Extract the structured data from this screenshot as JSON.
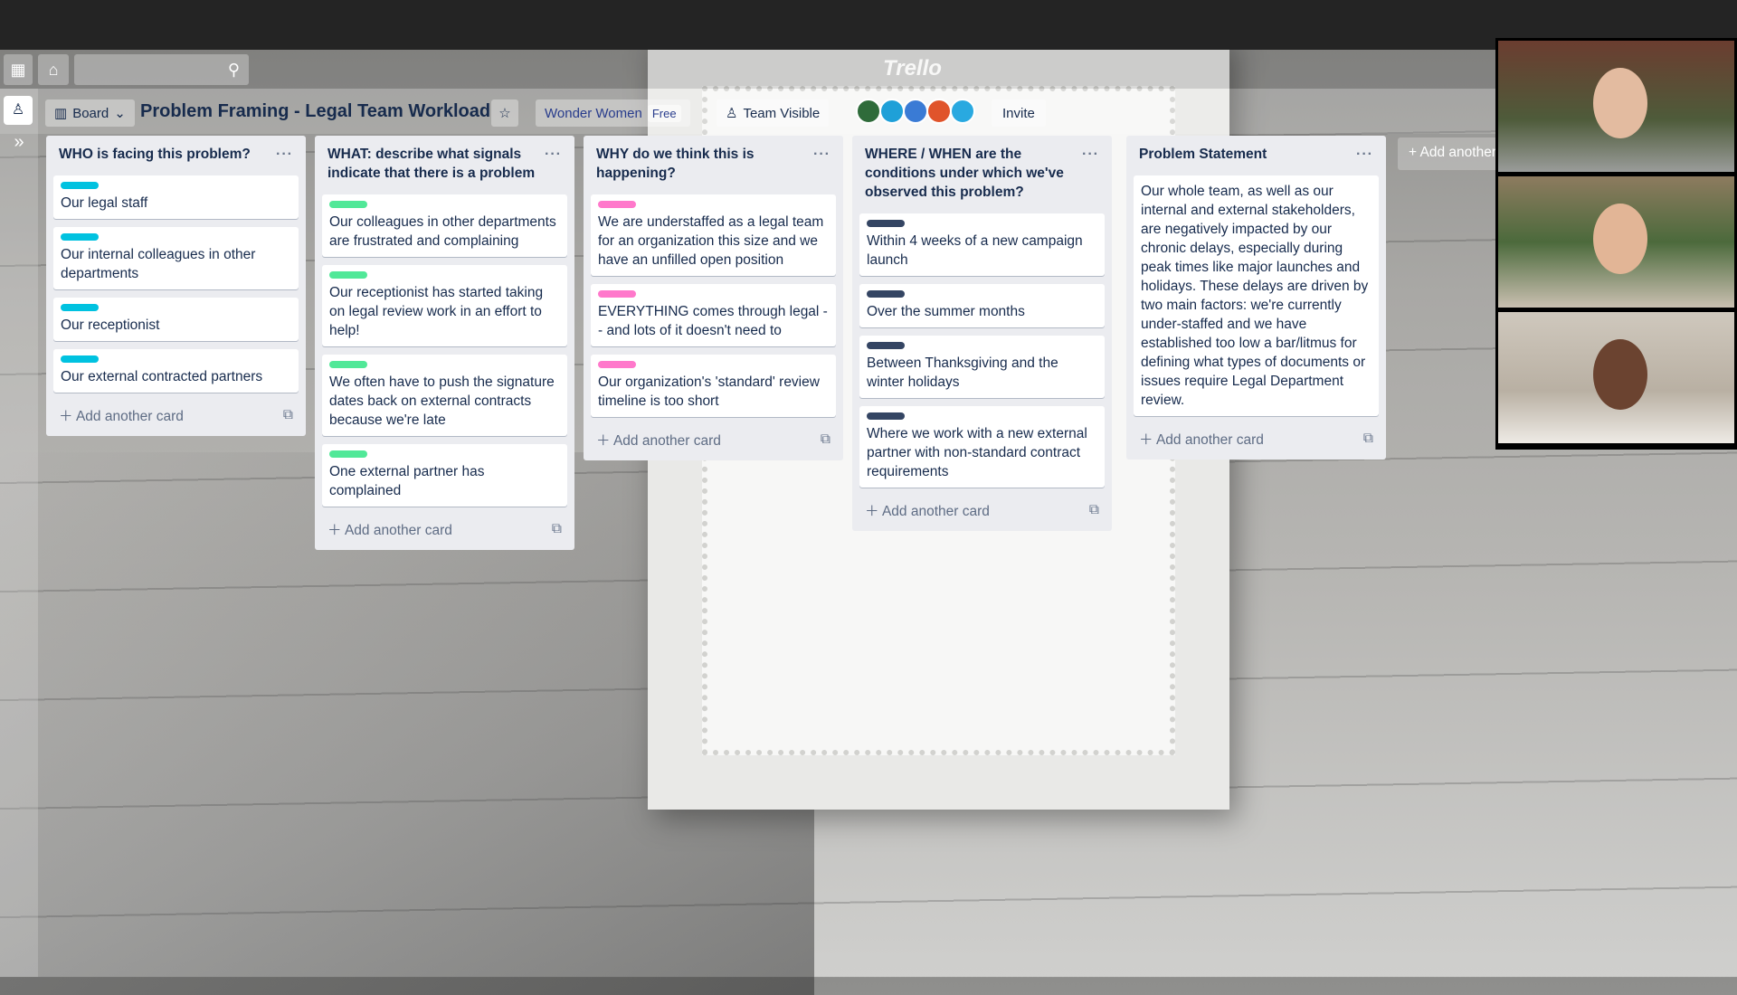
{
  "header": {
    "board_switch": "Board",
    "board_title": "Problem Framing - Legal Team Workload",
    "team": "Wonder Women",
    "plan": "Free",
    "visibility": "Team Visible",
    "invite": "Invite",
    "logo": "Trello",
    "search_placeholder": ""
  },
  "members": [
    {
      "color": "#2f6b3a"
    },
    {
      "color": "#1fa0d8"
    },
    {
      "color": "#3a7bd5"
    },
    {
      "color": "#e0542b"
    },
    {
      "color": "#29a9e0"
    }
  ],
  "add_card_label": "Add another card",
  "add_list_label": "Add another list",
  "lists": [
    {
      "title": "WHO is facing this problem?",
      "label_color": "#00c2e0",
      "cards": [
        "Our legal staff",
        "Our internal colleagues in other departments",
        "Our receptionist",
        "Our external contracted partners"
      ]
    },
    {
      "title": "WHAT: describe what signals indicate that there is a problem",
      "label_color": "#51e898",
      "cards": [
        "Our colleagues in other departments are frustrated and complaining",
        "Our receptionist has started taking on legal review work in an effort to help!",
        "We often have to push the signature dates back on external contracts because we're late",
        "One external partner has complained"
      ]
    },
    {
      "title": "WHY do we think this is happening?",
      "label_color": "#ff78cb",
      "cards": [
        "We are understaffed as a legal team for an organization this size and we have an unfilled open position",
        "EVERYTHING comes through legal -- and lots of it doesn't need to",
        "Our organization's 'standard' review timeline is too short"
      ]
    },
    {
      "title": "WHERE / WHEN are the conditions under which we've observed this problem?",
      "label_color": "#344563",
      "cards": [
        "Within 4 weeks of a new campaign launch",
        "Over the summer months",
        "Between Thanksgiving and the winter holidays",
        "Where we work with a new external partner with non-standard contract requirements"
      ]
    },
    {
      "title": "Problem Statement",
      "label_color": null,
      "cards": [
        "Our whole team, as well as our internal and external stakeholders, are negatively impacted by our chronic delays, especially during peak times like major launches and holidays. These delays are driven by two main factors: we're currently under-staffed and we have established too low a bar/litmus for defining what types of documents or issues require Legal Department review."
      ]
    }
  ]
}
